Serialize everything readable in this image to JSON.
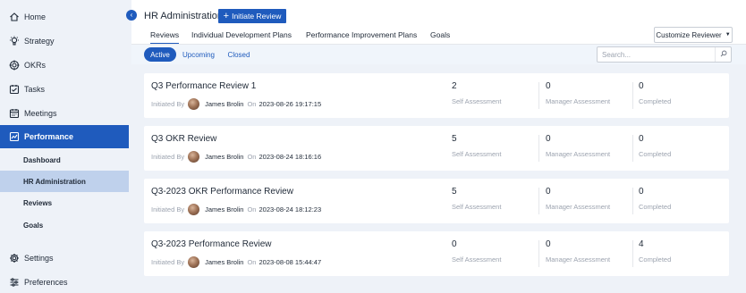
{
  "sidebar": {
    "items": [
      {
        "label": "Home",
        "icon": "home-icon"
      },
      {
        "label": "Strategy",
        "icon": "bulb-icon"
      },
      {
        "label": "OKRs",
        "icon": "target-icon"
      },
      {
        "label": "Tasks",
        "icon": "checklist-icon"
      },
      {
        "label": "Meetings",
        "icon": "calendar-icon"
      },
      {
        "label": "Performance",
        "icon": "chart-icon"
      }
    ],
    "sub_items": [
      {
        "label": "Dashboard"
      },
      {
        "label": "HR Administration"
      },
      {
        "label": "Reviews"
      },
      {
        "label": "Goals"
      }
    ],
    "bottom_items": [
      {
        "label": "Settings",
        "icon": "gear-icon"
      },
      {
        "label": "Preferences",
        "icon": "sliders-icon"
      }
    ]
  },
  "header": {
    "title": "HR Administration",
    "initiate_label": "Initiate Review",
    "tabs": [
      {
        "label": "Reviews"
      },
      {
        "label": "Individual Development Plans"
      },
      {
        "label": "Performance Improvement Plans"
      },
      {
        "label": "Goals"
      }
    ],
    "customize_label": "Customize Reviewer"
  },
  "filters": {
    "status": [
      {
        "label": "Active"
      },
      {
        "label": "Upcoming"
      },
      {
        "label": "Closed"
      }
    ],
    "search_placeholder": "Search..."
  },
  "reviews": [
    {
      "title": "Q3 Performance Review 1",
      "initiated_by_label": "Initiated By",
      "initiator": "James Brolin",
      "on_label": "On",
      "date": "2023-08-26 19:17:15",
      "self_assessment": "2",
      "manager_assessment": "0",
      "completed": "0",
      "self_label": "Self Assessment",
      "manager_label": "Manager Assessment",
      "completed_label": "Completed"
    },
    {
      "title": "Q3 OKR Review",
      "initiated_by_label": "Initiated By",
      "initiator": "James Brolin",
      "on_label": "On",
      "date": "2023-08-24 18:16:16",
      "self_assessment": "5",
      "manager_assessment": "0",
      "completed": "0",
      "self_label": "Self Assessment",
      "manager_label": "Manager Assessment",
      "completed_label": "Completed"
    },
    {
      "title": "Q3-2023 OKR Performance Review",
      "initiated_by_label": "Initiated By",
      "initiator": "James Brolin",
      "on_label": "On",
      "date": "2023-08-24 18:12:23",
      "self_assessment": "5",
      "manager_assessment": "0",
      "completed": "0",
      "self_label": "Self Assessment",
      "manager_label": "Manager Assessment",
      "completed_label": "Completed"
    },
    {
      "title": "Q3-2023 Performance Review",
      "initiated_by_label": "Initiated By",
      "initiator": "James Brolin",
      "on_label": "On",
      "date": "2023-08-08 15:44:47",
      "self_assessment": "0",
      "manager_assessment": "0",
      "completed": "4",
      "self_label": "Self Assessment",
      "manager_label": "Manager Assessment",
      "completed_label": "Completed"
    }
  ],
  "colors": {
    "accent": "#1f5bbd",
    "sidebar_bg": "#eef2f8",
    "selected_sub": "#bfd1ec"
  }
}
